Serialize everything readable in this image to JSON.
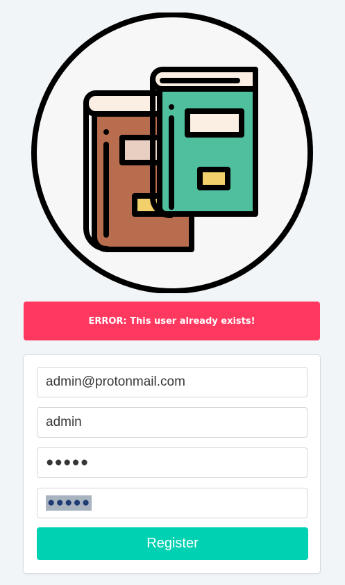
{
  "logo": {
    "icon": "books-icon"
  },
  "alert": {
    "message": "ERROR: This user already exists!"
  },
  "form": {
    "email_value": "admin@protonmail.com",
    "username_value": "admin",
    "password_value": "●●●●●",
    "confirm_password_value": "●●●●●",
    "submit_label": "Register"
  },
  "colors": {
    "background": "#f1f5f8",
    "alert": "#ff3860",
    "button": "#00d1b2"
  }
}
